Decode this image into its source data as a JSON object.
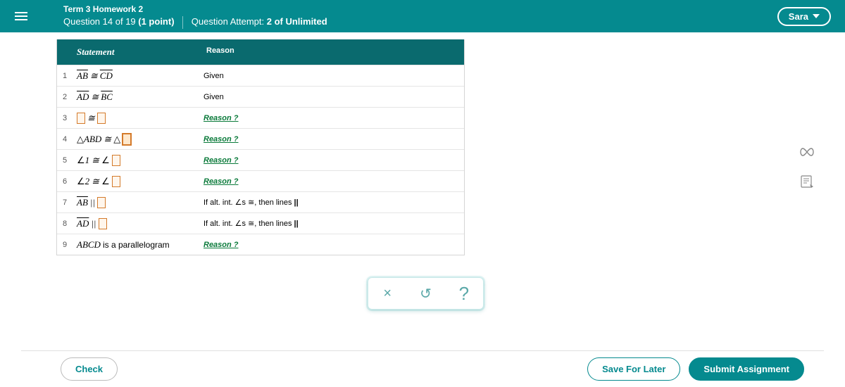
{
  "header": {
    "assignment_title": "Term 3 Homework 2",
    "question_prefix": "Question ",
    "question_num": "14",
    "question_of": " of 19 ",
    "points": "(1 point)",
    "attempt_label": "Question Attempt: ",
    "attempt_value": "2 of Unlimited",
    "user_name": "Sara"
  },
  "table": {
    "head_statement": "Statement",
    "head_reason": "Reason",
    "rows": [
      {
        "n": "1",
        "stmt_type": "seg_cong_seg",
        "a": "AB",
        "b": "CD",
        "reason_type": "text",
        "reason": "Given"
      },
      {
        "n": "2",
        "stmt_type": "seg_cong_seg",
        "a": "AD",
        "b": "BC",
        "reason_type": "text",
        "reason": "Given"
      },
      {
        "n": "3",
        "stmt_type": "blank_cong_blank",
        "reason_type": "link",
        "reason": "Reason ?"
      },
      {
        "n": "4",
        "stmt_type": "tri_cong_triblank",
        "a": "ABD",
        "reason_type": "link",
        "reason": "Reason ?"
      },
      {
        "n": "5",
        "stmt_type": "ang_cong_angblank",
        "a": "1",
        "reason_type": "link",
        "reason": "Reason ?"
      },
      {
        "n": "6",
        "stmt_type": "ang_cong_angblank",
        "a": "2",
        "reason_type": "link",
        "reason": "Reason ?"
      },
      {
        "n": "7",
        "stmt_type": "seg_par_blank",
        "a": "AB",
        "reason_type": "altint",
        "reason_pre": "If alt. int. ",
        "reason_mid": "s ≅, then lines  ",
        "par": "||"
      },
      {
        "n": "8",
        "stmt_type": "seg_par_blank",
        "a": "AD",
        "reason_type": "altint",
        "reason_pre": "If alt. int. ",
        "reason_mid": "s ≅, then lines  ",
        "par": "||"
      },
      {
        "n": "9",
        "stmt_type": "plain",
        "text": "ABCD",
        "after": " is a parallelogram",
        "reason_type": "link",
        "reason": "Reason ?"
      }
    ]
  },
  "toolbar": {
    "close": "×",
    "undo": "↺",
    "help": "?"
  },
  "side": {
    "infinity": "∞",
    "notes": "notes"
  },
  "footer": {
    "check": "Check",
    "save": "Save For Later",
    "submit": "Submit Assignment"
  }
}
